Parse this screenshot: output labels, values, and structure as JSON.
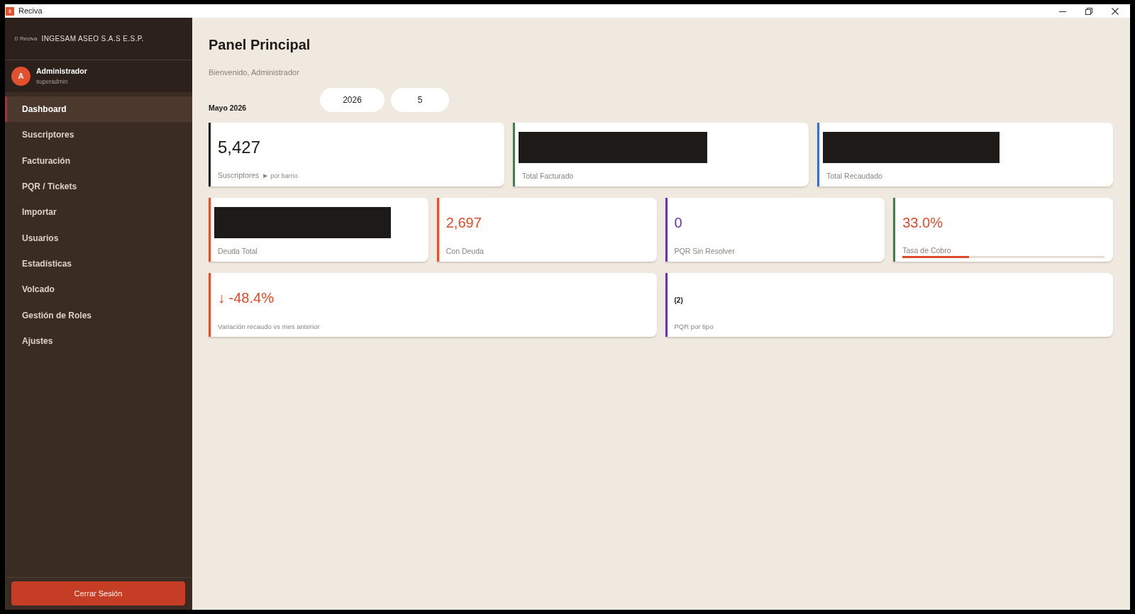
{
  "window": {
    "title": "Reciva"
  },
  "sidebar": {
    "logo_text": "Reciva",
    "company": "INGESAM ASEO S.A.S E.S.P.",
    "user": {
      "initial": "A",
      "name": "Administrador",
      "role": "superadmin"
    },
    "items": [
      {
        "label": "Dashboard",
        "selected": true
      },
      {
        "label": "Suscriptores",
        "selected": false
      },
      {
        "label": "Facturación",
        "selected": false
      },
      {
        "label": "PQR / Tickets",
        "selected": false
      },
      {
        "label": "Importar",
        "selected": false
      },
      {
        "label": "Usuarios",
        "selected": false
      },
      {
        "label": "Estadísticas",
        "selected": false
      },
      {
        "label": "Volcado",
        "selected": false
      },
      {
        "label": "Gestión de Roles",
        "selected": false
      },
      {
        "label": "Ajustes",
        "selected": false
      }
    ],
    "logout": "Cerrar Sesión"
  },
  "page": {
    "title": "Panel Principal",
    "subtitle": "Bienvenido, Administrador",
    "period": "Mayo 2026",
    "year": "2026",
    "month": "5"
  },
  "stat_rows": [
    {
      "cards": [
        {
          "kind": "figure",
          "value": {
            "text": "5,427",
            "color": "#1d1a18"
          },
          "label": "Suscriptores",
          "link": {
            "arrow": "►",
            "text": "por barrio"
          },
          "color": "#1d1a18"
        },
        {
          "kind": "redacted",
          "label": "Total Facturado",
          "color": "#2e8b45"
        },
        {
          "kind": "redacted",
          "label": "Total Recaudado",
          "color": "#3a6fcf"
        }
      ]
    },
    {
      "cards": [
        {
          "kind": "redacted",
          "label": "Deuda Total",
          "color": "#e2502f"
        },
        {
          "kind": "metric",
          "value": {
            "text": "2,697",
            "color": "#e04a2a"
          },
          "label": "Con Deuda",
          "color": "#e2502f"
        },
        {
          "kind": "metric",
          "value": {
            "text": "0",
            "color": "#6a35b0"
          },
          "label": "PQR Sin Resolver",
          "color": "#6a35b0"
        },
        {
          "kind": "progress",
          "value": {
            "text": "33.0%",
            "color": "#e04a2a"
          },
          "label": "Tasa de Cobro",
          "level": 0.33,
          "color": "#2e8b45"
        }
      ]
    },
    {
      "cards": [
        {
          "kind": "metric",
          "value": {
            "text": "↓ -48.4%",
            "color": "#e04a2a"
          },
          "label": "Variación recaudo vs mes anterior",
          "color": "#e2502f"
        },
        {
          "kind": "count",
          "value": {
            "text": "(2)",
            "color": "#1d1a18"
          },
          "label": "PQR por tipo",
          "color": "#6a35b0"
        }
      ]
    }
  ]
}
